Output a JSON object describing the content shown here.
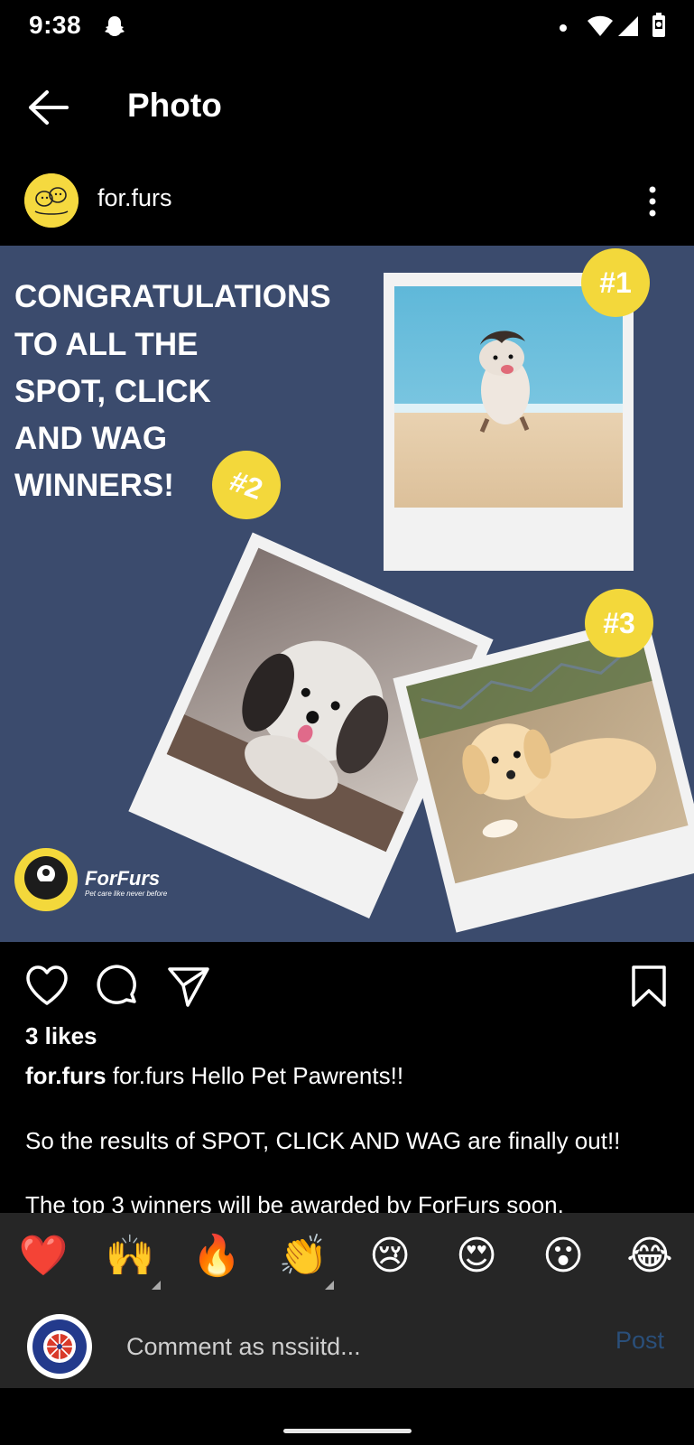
{
  "status_bar": {
    "time": "9:38"
  },
  "header": {
    "title": "Photo"
  },
  "post": {
    "username": "for.furs",
    "image": {
      "headline_lines": [
        "CONGRATULATIONS",
        "TO ALL THE",
        "SPOT, CLICK",
        "AND WAG",
        "WINNERS!"
      ],
      "badges": [
        "#1",
        "#2",
        "#3"
      ],
      "brand_name": "ForFurs",
      "brand_tagline": "Pet care like never before"
    },
    "likes": "3 likes",
    "caption": {
      "user": "for.furs",
      "text": "for.furs Hello Pet Pawrents!!",
      "line2": "So the results of SPOT, CLICK AND WAG are finally out!!",
      "line3": "The top 3 winners will be awarded by ForFurs soon."
    }
  },
  "reactions": [
    {
      "name": "red-heart",
      "glyph": "❤️"
    },
    {
      "name": "raising-hands",
      "glyph": "🙌"
    },
    {
      "name": "fire",
      "glyph": "🔥"
    },
    {
      "name": "clapping-hands",
      "glyph": "👏"
    },
    {
      "name": "crying-face",
      "glyph": "😢"
    },
    {
      "name": "heart-eyes",
      "glyph": "😍"
    },
    {
      "name": "surprised-face",
      "glyph": "😮"
    },
    {
      "name": "tears-of-joy",
      "glyph": "😂"
    }
  ],
  "comment": {
    "placeholder": "Comment as nssiitd...",
    "post_label": "Post"
  },
  "colors": {
    "background": "#000000",
    "post_bg": "#3b4b6d",
    "badge_yellow": "#f3d83b",
    "bar_bg": "#262626",
    "post_button": "#2a4f7a"
  }
}
